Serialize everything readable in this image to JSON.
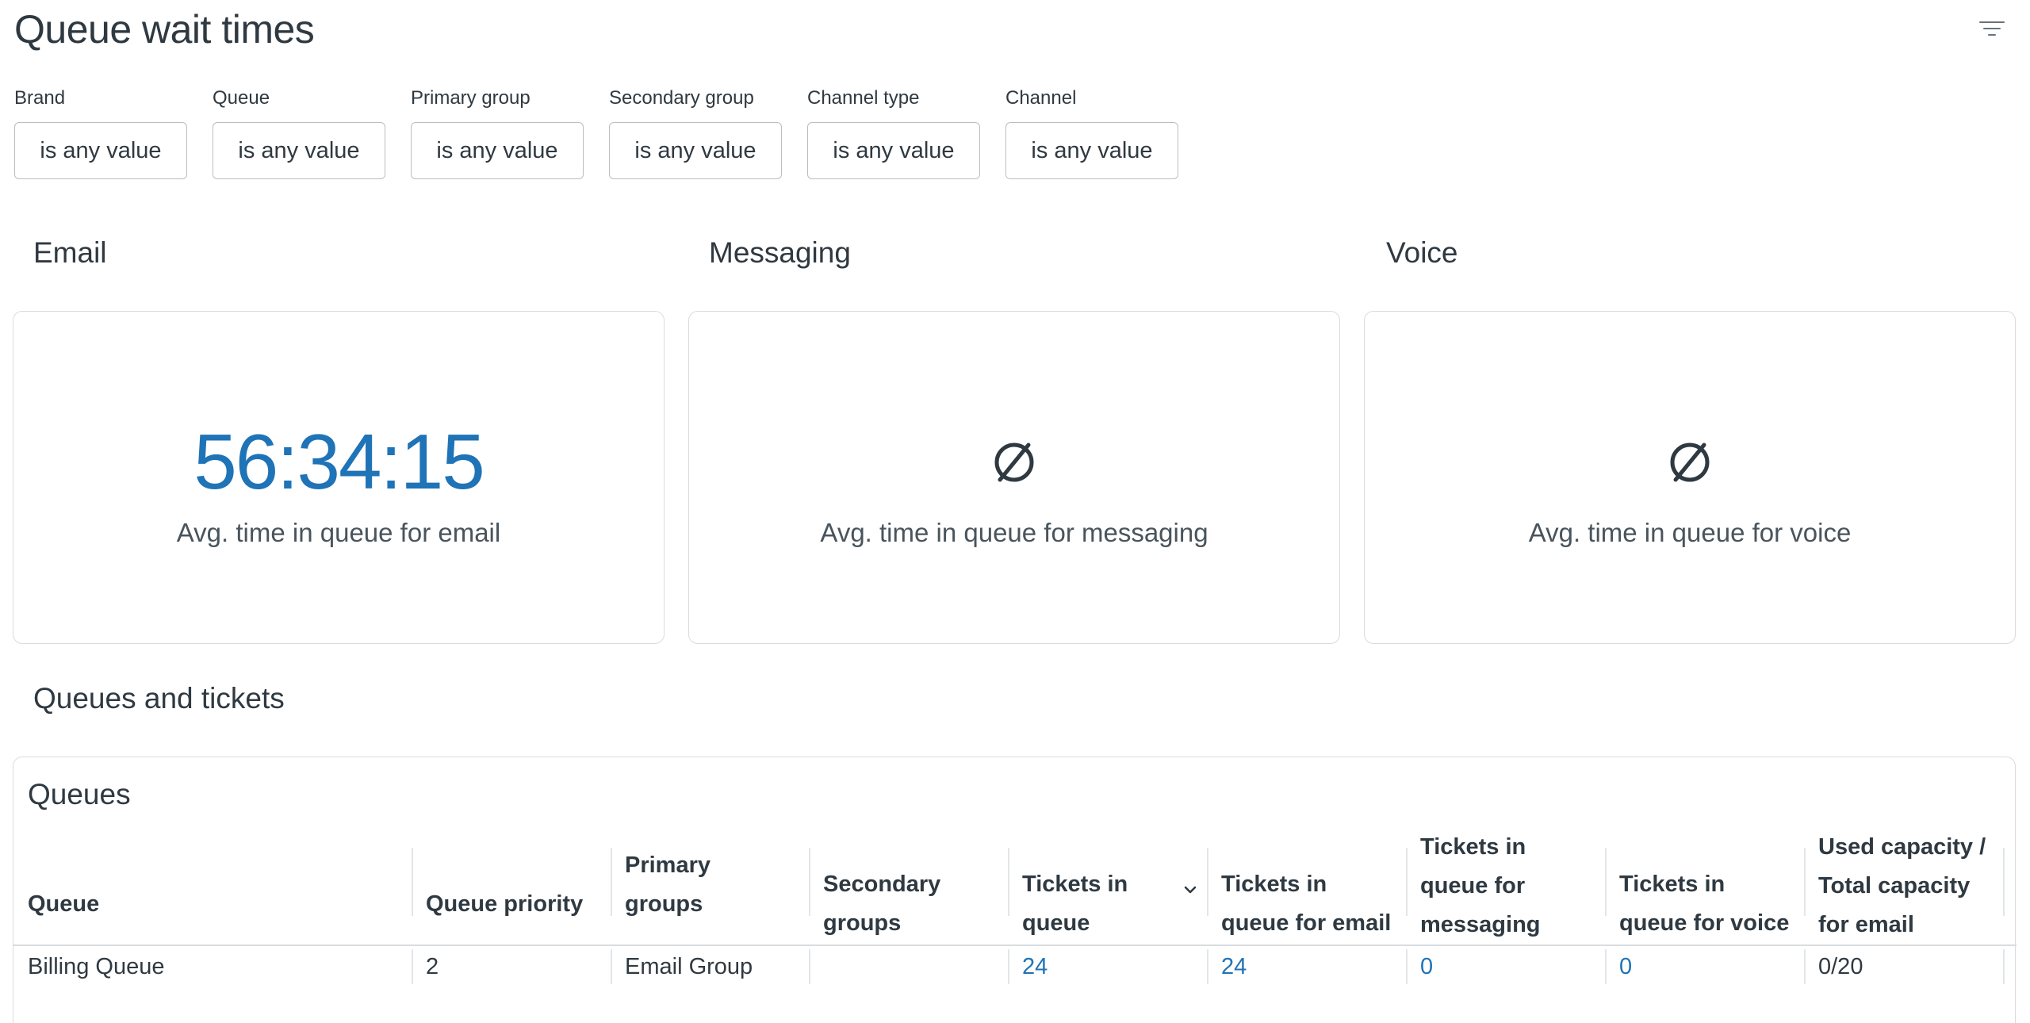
{
  "header": {
    "title": "Queue wait times",
    "filter_toggle_icon": "filter-lines-icon"
  },
  "filters": [
    {
      "label": "Brand",
      "value": "is any value"
    },
    {
      "label": "Queue",
      "value": "is any value"
    },
    {
      "label": "Primary group",
      "value": "is any value"
    },
    {
      "label": "Secondary group",
      "value": "is any value"
    },
    {
      "label": "Channel type",
      "value": "is any value"
    },
    {
      "label": "Channel",
      "value": "is any value"
    }
  ],
  "metrics": [
    {
      "heading": "Email",
      "value": "56:34:15",
      "label": "Avg. time in queue for email"
    },
    {
      "heading": "Messaging",
      "value": "",
      "icon": "empty-set-icon",
      "label": "Avg. time in queue for messaging"
    },
    {
      "heading": "Voice",
      "value": "",
      "icon": "empty-set-icon",
      "label": "Avg. time in queue for voice"
    }
  ],
  "queues_section": {
    "heading": "Queues and tickets",
    "table_title": "Queues",
    "columns": [
      "Queue",
      "Queue priority",
      "Primary groups",
      "Secondary groups",
      "Tickets in queue",
      "Tickets in queue for email",
      "Tickets in queue for messaging",
      "Tickets in queue for voice",
      "Used capacity / Total capacity for email"
    ],
    "sort_icon": "chevron-down-icon",
    "rows": [
      {
        "queue": "Billing Queue",
        "priority": "2",
        "primary_groups": "Email Group",
        "secondary_groups": "",
        "tickets_in_queue": "24",
        "tickets_email": "24",
        "tickets_messaging": "0",
        "tickets_voice": "0",
        "capacity_email": "0/20"
      }
    ]
  },
  "colors": {
    "accent": "#1f73b7",
    "text": "#2f3941",
    "border": "#d8dcde"
  }
}
